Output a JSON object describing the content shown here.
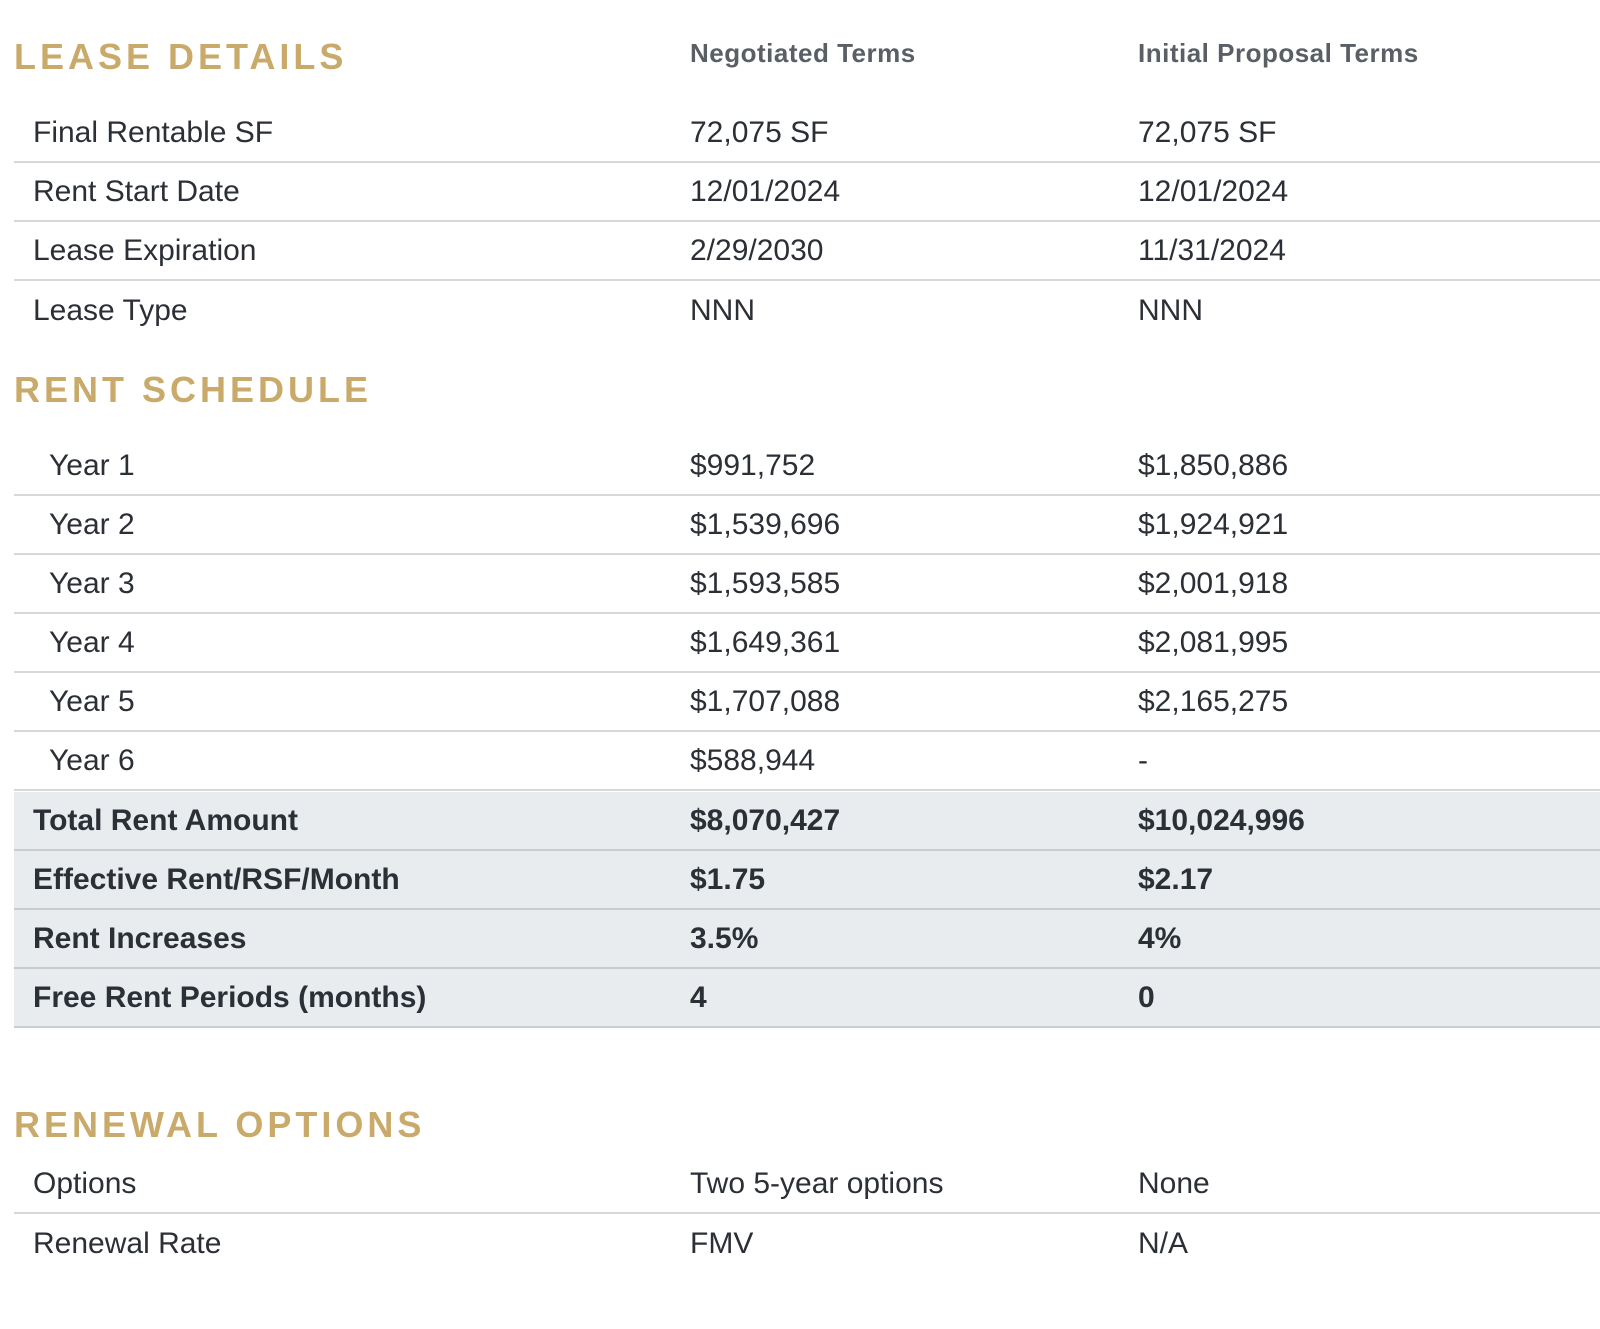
{
  "lease_details": {
    "heading": "LEASE DETAILS",
    "col_negotiated": "Negotiated Terms",
    "col_initial": "Initial Proposal Terms",
    "rows": [
      {
        "label": "Final Rentable SF",
        "negotiated": "72,075 SF",
        "initial": "72,075 SF"
      },
      {
        "label": "Rent Start Date",
        "negotiated": "12/01/2024",
        "initial": "12/01/2024"
      },
      {
        "label": "Lease Expiration",
        "negotiated": "2/29/2030",
        "initial": "11/31/2024"
      },
      {
        "label": "Lease Type",
        "negotiated": "NNN",
        "initial": "NNN"
      }
    ]
  },
  "rent_schedule": {
    "heading": "RENT SCHEDULE",
    "rows": [
      {
        "label": "Year 1",
        "negotiated": "$991,752",
        "initial": "$1,850,886"
      },
      {
        "label": "Year 2",
        "negotiated": "$1,539,696",
        "initial": "$1,924,921"
      },
      {
        "label": "Year 3",
        "negotiated": "$1,593,585",
        "initial": "$2,001,918"
      },
      {
        "label": "Year 4",
        "negotiated": "$1,649,361",
        "initial": "$2,081,995"
      },
      {
        "label": "Year 5",
        "negotiated": "$1,707,088",
        "initial": "$2,165,275"
      },
      {
        "label": "Year 6",
        "negotiated": "$588,944",
        "initial": "-"
      }
    ],
    "summary": [
      {
        "label": "Total Rent Amount",
        "negotiated": "$8,070,427",
        "initial": "$10,024,996"
      },
      {
        "label": "Effective Rent/RSF/Month",
        "negotiated": "$1.75",
        "initial": "$2.17"
      },
      {
        "label": "Rent Increases",
        "negotiated": "3.5%",
        "initial": "4%"
      },
      {
        "label": "Free Rent Periods (months)",
        "negotiated": "4",
        "initial": "0"
      }
    ]
  },
  "renewal_options": {
    "heading": "RENEWAL OPTIONS",
    "rows": [
      {
        "label": "Options",
        "negotiated": "Two 5-year options",
        "initial": "None"
      },
      {
        "label": "Renewal Rate",
        "negotiated": "FMV",
        "initial": "N/A"
      }
    ]
  },
  "colors": {
    "heading_gold": "#c9aa6a",
    "summary_bg": "#e8ecef",
    "text": "#2b2f36"
  }
}
